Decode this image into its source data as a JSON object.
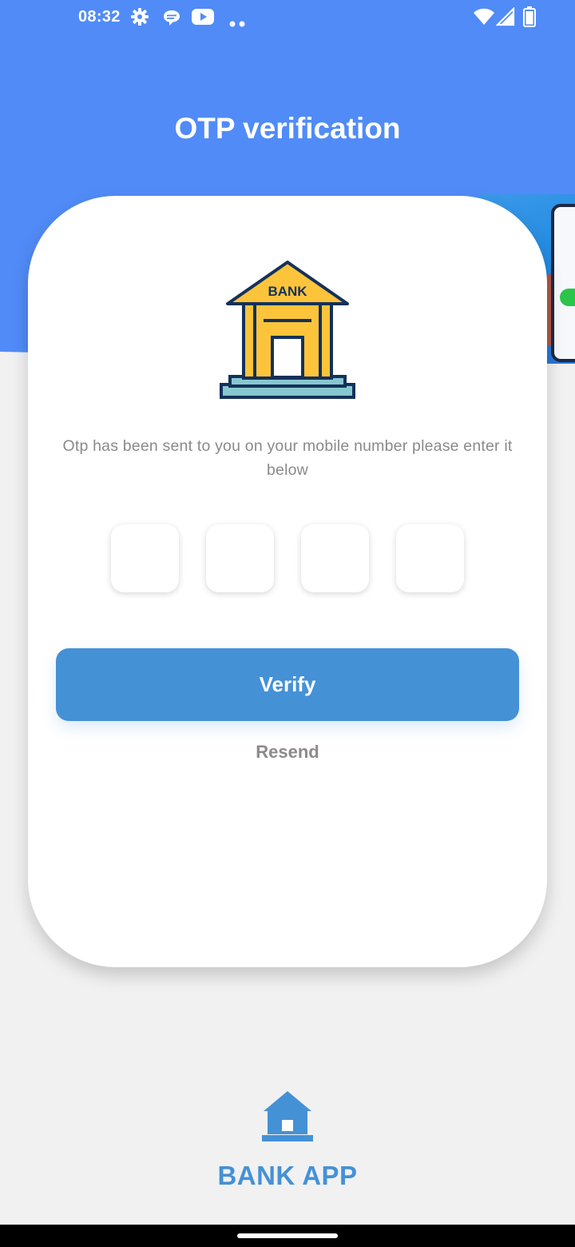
{
  "status_bar": {
    "time": "08:32",
    "left_icons": [
      "settings-icon",
      "chat-bubble-icon",
      "youtube-icon",
      "more-dots-icon"
    ],
    "right_icons": [
      "wifi-icon",
      "cellular-signal-icon",
      "battery-icon"
    ]
  },
  "header": {
    "title": "OTP verification",
    "background_color": "#518bf7"
  },
  "card": {
    "illustration": "bank-building-icon",
    "illustration_label": "BANK",
    "message": "Otp has been sent to you on your mobile number please enter it below",
    "otp_fields": [
      {
        "value": ""
      },
      {
        "value": ""
      },
      {
        "value": ""
      },
      {
        "value": ""
      }
    ],
    "verify_label": "Verify",
    "resend_label": "Resend"
  },
  "footer": {
    "logo": "bank-home-icon",
    "app_name": "BANK APP"
  },
  "colors": {
    "accent": "#4591d6",
    "page_background": "#f1f1f2",
    "text_muted": "#8a8a8a"
  }
}
